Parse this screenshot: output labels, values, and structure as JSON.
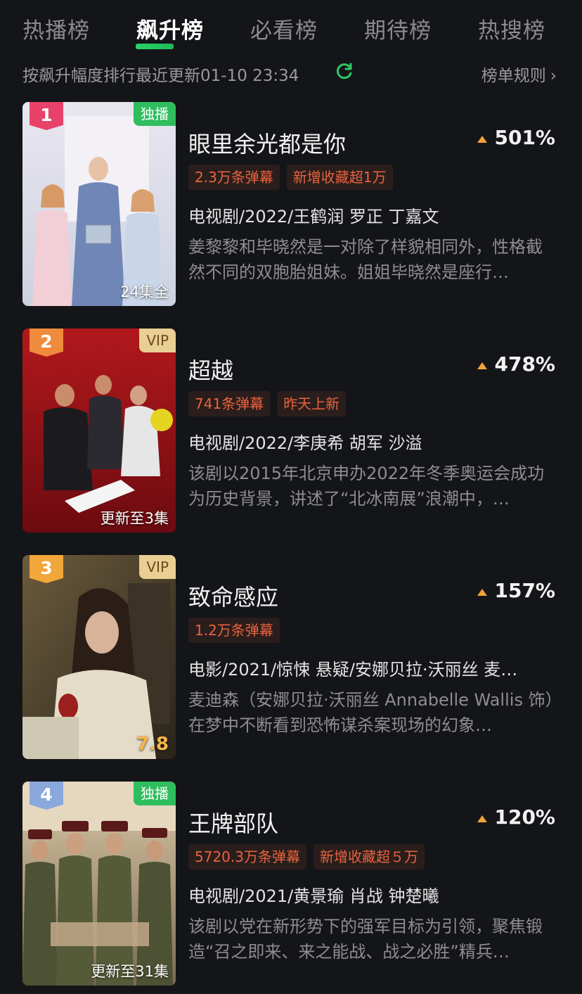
{
  "tabs": [
    {
      "label": "热播榜"
    },
    {
      "label": "飙升榜"
    },
    {
      "label": "必看榜"
    },
    {
      "label": "期待榜"
    },
    {
      "label": "热搜榜"
    }
  ],
  "active_tab": "飙升榜",
  "subbar": {
    "sort_text": "按飙升幅度排行最近更新01-10 23:34",
    "rules_label": "榜单规则"
  },
  "items": [
    {
      "rank": "1",
      "corner_tag": "独播",
      "poster_foot": "24集全",
      "title": "眼里余光都是你",
      "rise": "501%",
      "chips": [
        "2.3万条弹幕",
        "新增收藏超1万"
      ],
      "meta": "电视剧/2022/王鹤润 罗正 丁嘉文",
      "desc": "姜黎黎和毕晓然是一对除了样貌相同外，性格截然不同的双胞胎姐妹。姐姐毕晓然是座行…"
    },
    {
      "rank": "2",
      "corner_tag": "VIP",
      "poster_foot": "更新至3集",
      "title": "超越",
      "rise": "478%",
      "chips": [
        "741条弹幕",
        "昨天上新"
      ],
      "meta": "电视剧/2022/李庚希 胡军 沙溢",
      "desc": "该剧以2015年北京申办2022年冬季奥运会成功为历史背景，讲述了“北冰南展”浪潮中，…"
    },
    {
      "rank": "3",
      "corner_tag": "VIP",
      "poster_foot": "7.8",
      "title": "致命感应",
      "rise": "157%",
      "chips": [
        "1.2万条弹幕"
      ],
      "meta": "电影/2021/惊悚 悬疑/安娜贝拉·沃丽丝 麦…",
      "desc": "麦迪森（安娜贝拉·沃丽丝 Annabelle Wallis 饰）在梦中不断看到恐怖谋杀案现场的幻象…"
    },
    {
      "rank": "4",
      "corner_tag": "独播",
      "poster_foot": "更新至31集",
      "title": "王牌部队",
      "rise": "120%",
      "chips": [
        "5720.3万条弹幕",
        "新增收藏超５万"
      ],
      "meta": "电视剧/2021/黄景瑜 肖战 钟楚曦",
      "desc": "该剧以党在新形势下的强军目标为引领，聚焦锻造“召之即来、来之能战、战之必胜”精兵…"
    }
  ],
  "colors": {
    "background": "#141518",
    "accent_green": "#28d56a",
    "chip_text": "#e8633f",
    "rise_arrow": "#f0a23a",
    "rank1": "#e8426a",
    "rank2": "#f08a3c",
    "rank3": "#f2a73b",
    "rank4": "#8aa8dc"
  }
}
